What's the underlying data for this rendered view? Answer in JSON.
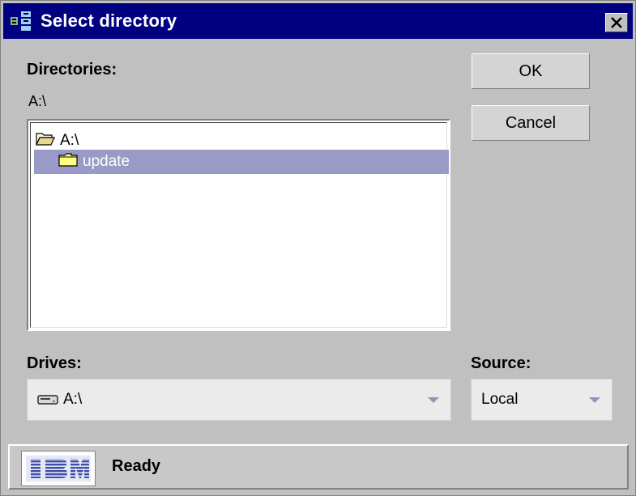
{
  "window": {
    "title": "Select directory"
  },
  "directories": {
    "label": "Directories:",
    "current_path": "A:\\",
    "tree": [
      {
        "label": "A:\\",
        "icon": "open-folder-icon",
        "selected": false
      },
      {
        "label": "update",
        "icon": "folder-icon",
        "selected": true
      }
    ]
  },
  "buttons": {
    "ok": "OK",
    "cancel": "Cancel"
  },
  "drives": {
    "label": "Drives:",
    "value": "A:\\",
    "icon": "drive-icon"
  },
  "source": {
    "label": "Source:",
    "value": "Local"
  },
  "status": {
    "logo": "IBM",
    "text": "Ready"
  },
  "colors": {
    "titlebar": "#000080",
    "selection": "#9a9ac7",
    "logo_blue": "#3c4ea8"
  }
}
